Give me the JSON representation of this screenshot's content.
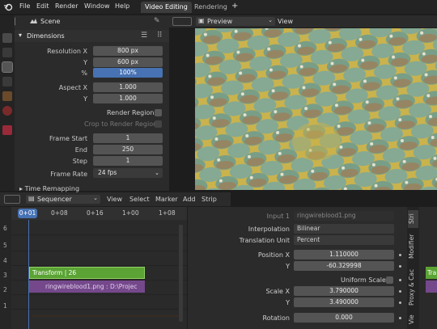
{
  "menubar": {
    "items": [
      "File",
      "Edit",
      "Render",
      "Window",
      "Help"
    ],
    "tabs": [
      "Video Editing",
      "Rendering"
    ],
    "add_tab": "+"
  },
  "properties": {
    "scene_label": "Scene",
    "section_title": "Dimensions",
    "fields": [
      {
        "label": "Resolution X",
        "value": "800 px"
      },
      {
        "label": "Y",
        "value": "600 px"
      },
      {
        "label": "%",
        "value": "100%"
      },
      {
        "label": "Aspect X",
        "value": "1.000"
      },
      {
        "label": "Y",
        "value": "1.000"
      }
    ],
    "render_region": "Render Region",
    "crop_region": "Crop to Render Region",
    "frames": [
      {
        "label": "Frame Start",
        "value": "1"
      },
      {
        "label": "End",
        "value": "250"
      },
      {
        "label": "Step",
        "value": "1"
      }
    ],
    "frame_rate_label": "Frame Rate",
    "frame_rate_value": "24 fps",
    "time_remapping": "Time Remapping"
  },
  "preview": {
    "mode": "Preview",
    "view_menu": "View"
  },
  "sequencer": {
    "editor": "Sequencer",
    "menus": [
      "View",
      "Select",
      "Marker",
      "Add",
      "Strip"
    ],
    "current_frame": "0+01",
    "ticks": [
      "0+08",
      "0+16",
      "1+00",
      "1+08"
    ],
    "channels": [
      "6",
      "5",
      "4",
      "3",
      "2",
      "1"
    ],
    "strips": {
      "transform": "Transform | 26",
      "image": "ringwireblood1.png : D:\\Projec"
    },
    "colors": {
      "transform": "#5aa334",
      "image": "#75488c",
      "playhead": "#4772b3"
    }
  },
  "strip_props": {
    "input_label": "Input 1",
    "input_value": "ringwireblood1.png",
    "interpolation_label": "Interpolation",
    "interpolation_value": "Bilinear",
    "translation_unit_label": "Translation Unit",
    "translation_unit_value": "Percent",
    "position_x_label": "Position X",
    "position_x_value": "1.110000",
    "position_y_label": "Y",
    "position_y_value": "-60.329998",
    "uniform_scale": "Uniform Scale",
    "scale_x_label": "Scale X",
    "scale_x_value": "3.790000",
    "scale_y_label": "Y",
    "scale_y_value": "3.490000",
    "rotation_label": "Rotation",
    "rotation_value": "0.000",
    "side_tabs": [
      "Stri",
      "Modifier",
      "Proxy & Cac",
      "Vie"
    ],
    "right_strip_label": "Tra"
  }
}
